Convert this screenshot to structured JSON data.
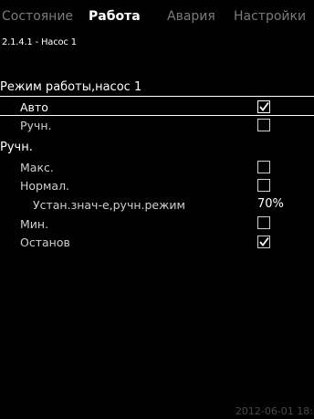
{
  "tabs": [
    {
      "label": "Состояние",
      "active": false
    },
    {
      "label": "Работа",
      "active": true
    },
    {
      "label": "Авария",
      "active": false
    },
    {
      "label": "Настройки",
      "active": false
    }
  ],
  "breadcrumb": "2.1.4.1 - Насос 1",
  "mode_section": {
    "title": "Режим работы,насос 1",
    "items": [
      {
        "label": "Авто",
        "checked": true
      },
      {
        "label": "Ручн.",
        "checked": false
      }
    ]
  },
  "manual_section": {
    "title": "Ручн.",
    "items": [
      {
        "label": "Макс.",
        "checked": false
      },
      {
        "label": "Нормал.",
        "checked": false
      },
      {
        "label": "Устан.знач-е,ручн.режим",
        "value": "70%"
      },
      {
        "label": "Мин.",
        "checked": false
      },
      {
        "label": "Останов",
        "checked": true
      }
    ]
  },
  "footer_datetime": "2012-06-01 18:2"
}
